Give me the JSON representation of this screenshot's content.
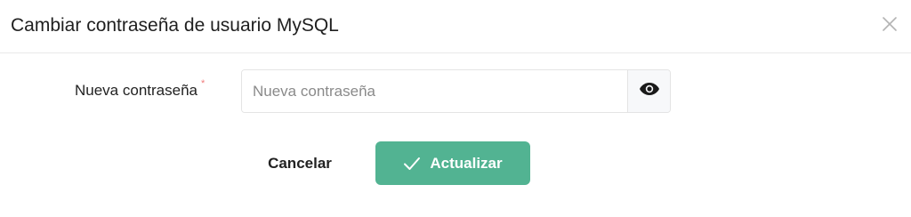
{
  "dialog": {
    "title": "Cambiar contraseña de usuario MySQL",
    "close_icon": "close-icon"
  },
  "form": {
    "password_label": "Nueva contraseña",
    "required_mark": "*",
    "password_placeholder": "Nueva contraseña",
    "password_value": "",
    "visibility_icon": "eye-icon"
  },
  "actions": {
    "cancel_label": "Cancelar",
    "update_label": "Actualizar",
    "update_icon": "check-icon"
  },
  "colors": {
    "primary": "#52b392",
    "required": "#f07b7b",
    "text": "#222222"
  }
}
